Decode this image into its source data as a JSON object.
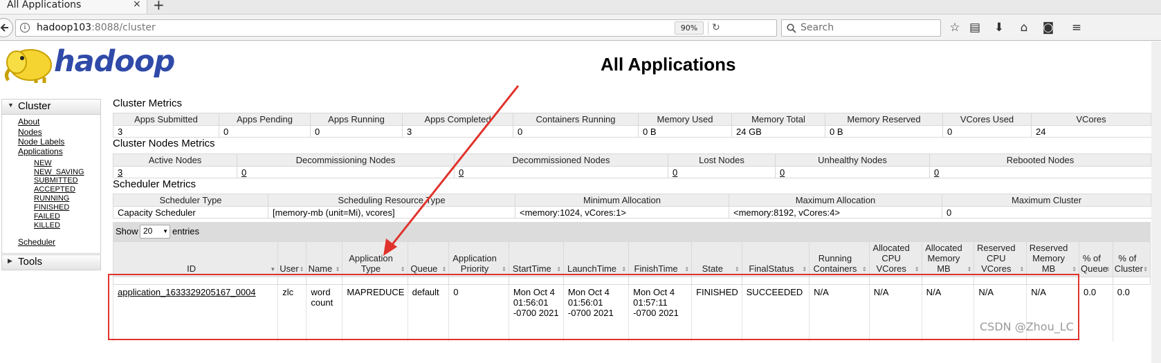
{
  "browser": {
    "tab_title": "All Applications",
    "tab_close": "×",
    "new_tab": "+",
    "url_host": "hadoop103",
    "url_rest": ":8088/cluster",
    "zoom": "90%",
    "search_placeholder": "Search"
  },
  "header": {
    "logo_text": "hadoop",
    "page_title": "All Applications"
  },
  "nav": {
    "cluster_label": "Cluster",
    "links": [
      "About",
      "Nodes",
      "Node Labels",
      "Applications"
    ],
    "states": [
      "NEW",
      "NEW_SAVING",
      "SUBMITTED",
      "ACCEPTED",
      "RUNNING",
      "FINISHED",
      "FAILED",
      "KILLED"
    ],
    "scheduler": "Scheduler",
    "tools_label": "Tools"
  },
  "cluster_metrics": {
    "title": "Cluster Metrics",
    "headers": [
      "Apps Submitted",
      "Apps Pending",
      "Apps Running",
      "Apps Completed",
      "Containers Running",
      "Memory Used",
      "Memory Total",
      "Memory Reserved",
      "VCores Used",
      "VCores"
    ],
    "values": [
      "3",
      "0",
      "0",
      "3",
      "0",
      "0 B",
      "24 GB",
      "0 B",
      "0",
      "24"
    ]
  },
  "node_metrics": {
    "title": "Cluster Nodes Metrics",
    "headers": [
      "Active Nodes",
      "Decommissioning Nodes",
      "Decommissioned Nodes",
      "Lost Nodes",
      "Unhealthy Nodes",
      "Rebooted Nodes"
    ],
    "values": [
      "3",
      "0",
      "0",
      "0",
      "0",
      "0"
    ]
  },
  "scheduler_metrics": {
    "title": "Scheduler Metrics",
    "headers": [
      "Scheduler Type",
      "Scheduling Resource Type",
      "Minimum Allocation",
      "Maximum Allocation",
      "Maximum Cluster"
    ],
    "values": [
      "Capacity Scheduler",
      "[memory-mb (unit=Mi), vcores]",
      "<memory:1024, vCores:1>",
      "<memory:8192, vCores:4>",
      "0"
    ]
  },
  "apps": {
    "show_label": "Show",
    "page_size": "20",
    "entries_label": "entries",
    "headers": [
      "ID",
      "User",
      "Name",
      "Application Type",
      "Queue",
      "Application Priority",
      "StartTime",
      "LaunchTime",
      "FinishTime",
      "State",
      "FinalStatus",
      "Running Containers",
      "Allocated CPU VCores",
      "Allocated Memory MB",
      "Reserved CPU VCores",
      "Reserved Memory MB",
      "% of Queue",
      "% of Cluster"
    ],
    "rows": [
      [
        "application_1633329205167_0004",
        "zlc",
        "word count",
        "MAPREDUCE",
        "default",
        "0",
        "Mon Oct 4 01:56:01 -0700 2021",
        "Mon Oct 4 01:56:01 -0700 2021",
        "Mon Oct 4 01:57:11 -0700 2021",
        "FINISHED",
        "SUCCEEDED",
        "N/A",
        "N/A",
        "N/A",
        "N/A",
        "N/A",
        "0.0",
        "0.0"
      ]
    ]
  },
  "watermark": "CSDN @Zhou_LC",
  "annotation_color": "#e0322c"
}
